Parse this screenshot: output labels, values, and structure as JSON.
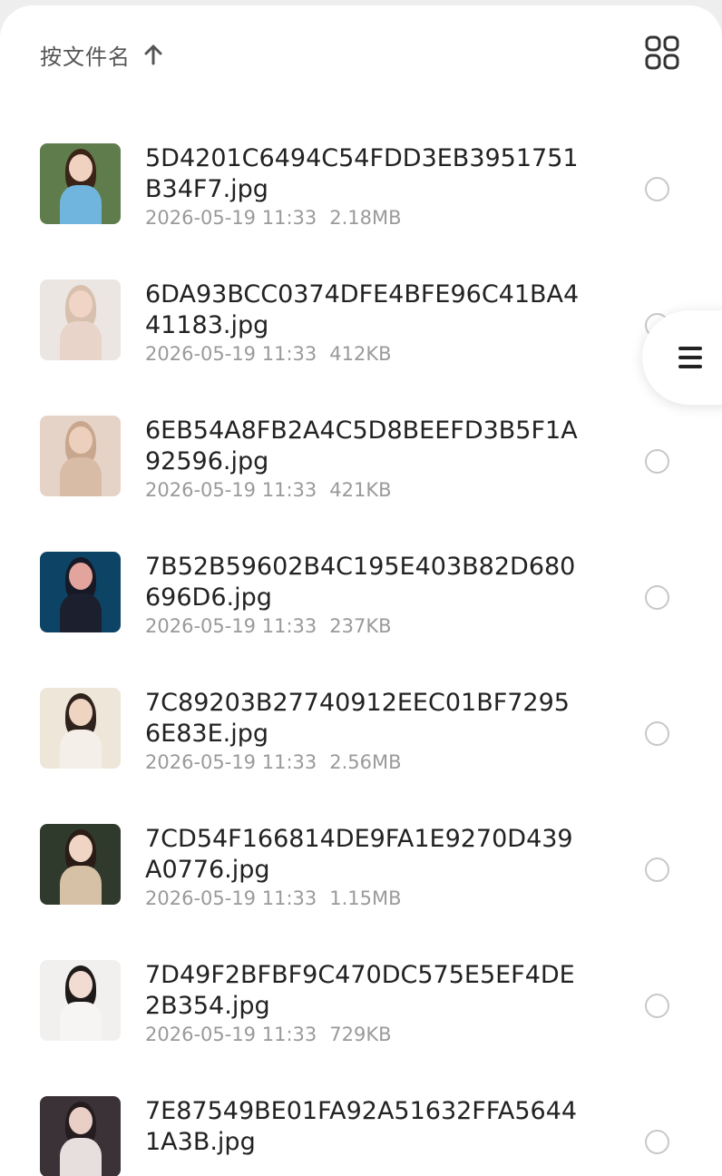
{
  "header": {
    "sort_label": "按文件名",
    "sort_direction_icon": "arrow-up-icon",
    "view_toggle_icon": "grid-view-icon"
  },
  "files": [
    {
      "name": "5D4201C6494C54FDD3EB3951751B34F7.jpg",
      "date": "2026-05-19 11:33",
      "size": "2.18MB",
      "thumb": {
        "bg": "#5f7d4c",
        "skin": "#f1d2c0",
        "hair": "#3a2418",
        "cloth": "#6fb5dd"
      }
    },
    {
      "name": "6DA93BCC0374DFE4BFE96C41BA441183.jpg",
      "date": "2026-05-19 11:33",
      "size": "412KB",
      "thumb": {
        "bg": "#ece6e2",
        "skin": "#f0d5c7",
        "hair": "#d7c0ae",
        "cloth": "#e8d4c8"
      }
    },
    {
      "name": "6EB54A8FB2A4C5D8BEEFD3B5F1A92596.jpg",
      "date": "2026-05-19 11:33",
      "size": "421KB",
      "thumb": {
        "bg": "#e4d3c6",
        "skin": "#ecd0bd",
        "hair": "#c9a78e",
        "cloth": "#d9bca6"
      }
    },
    {
      "name": "7B52B59602B4C195E403B82D680696D6.jpg",
      "date": "2026-05-19 11:33",
      "size": "237KB",
      "thumb": {
        "bg": "#0d4466",
        "skin": "#e2a49c",
        "hair": "#171a26",
        "cloth": "#1b1f2e"
      }
    },
    {
      "name": "7C89203B27740912EEC01BF72956E83E.jpg",
      "date": "2026-05-19 11:33",
      "size": "2.56MB",
      "thumb": {
        "bg": "#efe6da",
        "skin": "#efd4c2",
        "hair": "#2f221c",
        "cloth": "#f4efe8"
      }
    },
    {
      "name": "7CD54F166814DE9FA1E9270D439A0776.jpg",
      "date": "2026-05-19 11:33",
      "size": "1.15MB",
      "thumb": {
        "bg": "#2f3a2c",
        "skin": "#f0d4c4",
        "hair": "#2a1b16",
        "cloth": "#d6c0a6"
      }
    },
    {
      "name": "7D49F2BFBF9C470DC575E5EF4DE2B354.jpg",
      "date": "2026-05-19 11:33",
      "size": "729KB",
      "thumb": {
        "bg": "#f2f0ef",
        "skin": "#f2dbd1",
        "hair": "#1f1a1a",
        "cloth": "#f7f5f3"
      }
    },
    {
      "name": "7E87549BE01FA92A51632FFA56441A3B.jpg",
      "date": "",
      "size": "",
      "thumb": {
        "bg": "#3a3236",
        "skin": "#e9cfc6",
        "hair": "#241c1f",
        "cloth": "#e7dede"
      }
    }
  ],
  "side_tab": {
    "icon": "menu-icon"
  }
}
